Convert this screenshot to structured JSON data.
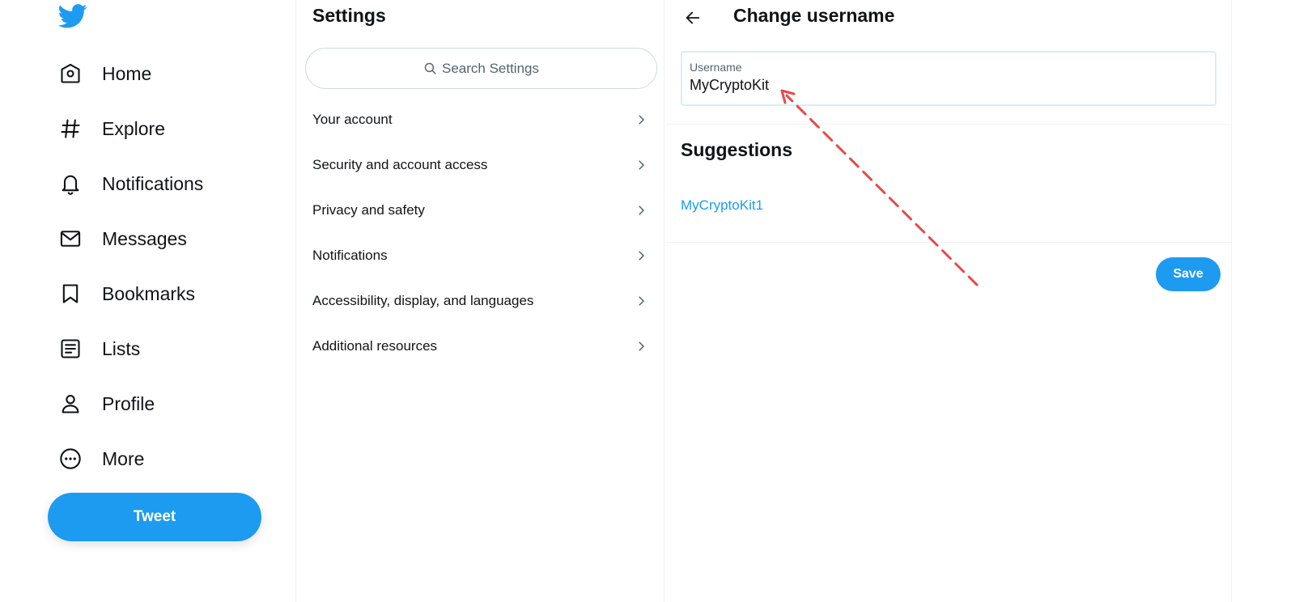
{
  "nav": {
    "items": [
      {
        "label": "Home",
        "icon": "home-icon"
      },
      {
        "label": "Explore",
        "icon": "hashtag-icon"
      },
      {
        "label": "Notifications",
        "icon": "bell-icon"
      },
      {
        "label": "Messages",
        "icon": "envelope-icon"
      },
      {
        "label": "Bookmarks",
        "icon": "bookmark-icon"
      },
      {
        "label": "Lists",
        "icon": "list-icon"
      },
      {
        "label": "Profile",
        "icon": "person-icon"
      },
      {
        "label": "More",
        "icon": "more-circle-icon"
      }
    ],
    "tweet_label": "Tweet"
  },
  "settings": {
    "title": "Settings",
    "search_placeholder": "Search Settings",
    "items": [
      {
        "label": "Your account"
      },
      {
        "label": "Security and account access"
      },
      {
        "label": "Privacy and safety"
      },
      {
        "label": "Notifications"
      },
      {
        "label": "Accessibility, display, and languages"
      },
      {
        "label": "Additional resources"
      }
    ]
  },
  "panel": {
    "title": "Change username",
    "field_label": "Username",
    "field_value": "MyCryptoKit",
    "suggestions_title": "Suggestions",
    "suggestions": [
      "MyCryptoKit1"
    ],
    "save_label": "Save"
  },
  "colors": {
    "accent": "#1d9bf0",
    "text": "#0f1419",
    "annotation_arrow": "#e84a4a"
  }
}
